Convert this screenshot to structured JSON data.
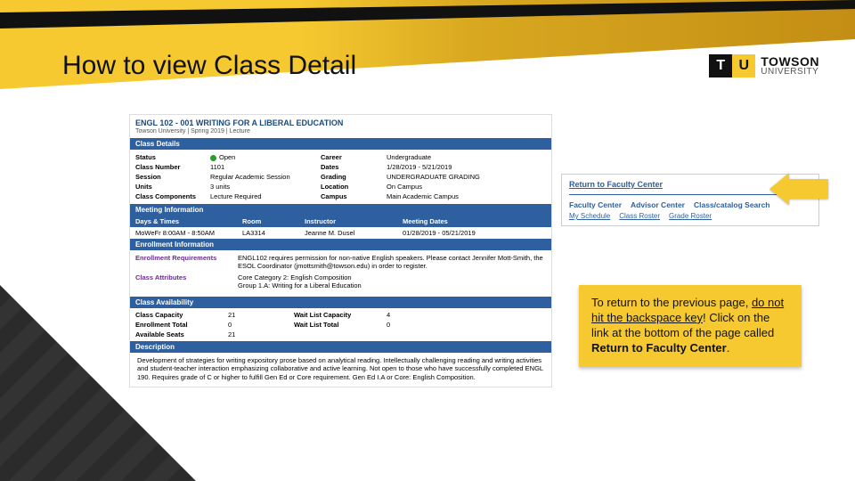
{
  "slide": {
    "title": "How to view Class Detail",
    "logo": {
      "mark1": "T",
      "mark2": "U",
      "line1": "TOWSON",
      "line2": "UNIVERSITY"
    }
  },
  "course": {
    "title": "ENGL 102 - 001   WRITING FOR A LIBERAL EDUCATION",
    "sub": "Towson University | Spring 2019 | Lecture"
  },
  "sections": {
    "classDetails": "Class Details",
    "meeting": "Meeting Information",
    "meetCols": {
      "days": "Days & Times",
      "room": "Room",
      "instr": "Instructor",
      "mdates": "Meeting Dates"
    },
    "enrollInfo": "Enrollment Information",
    "availability": "Class Availability",
    "description": "Description"
  },
  "details": {
    "statusLbl": "Status",
    "status": "Open",
    "classNumLbl": "Class Number",
    "classNum": "1101",
    "sessionLbl": "Session",
    "session": "Regular Academic Session",
    "unitsLbl": "Units",
    "units": "3 units",
    "compLbl": "Class Components",
    "comp": "Lecture Required",
    "careerLbl": "Career",
    "career": "Undergraduate",
    "datesLbl": "Dates",
    "dates": "1/28/2019 - 5/21/2019",
    "gradingLbl": "Grading",
    "grading": "UNDERGRADUATE GRADING",
    "locationLbl": "Location",
    "location": "On Campus",
    "campusLbl": "Campus",
    "campus": "Main Academic Campus"
  },
  "meeting": {
    "days": "MoWeFr 8:00AM - 8:50AM",
    "room": "LA3314",
    "instr": "Jeanne M. Dusel",
    "mdates": "01/28/2019 - 05/21/2019"
  },
  "enroll": {
    "reqLbl": "Enrollment Requirements",
    "req": "ENGL102 requires permission for non-native English speakers. Please contact Jennifer Mott-Smith, the ESOL Coordinator (jmottsmith@towson.edu) in order to register.",
    "attrLbl": "Class Attributes",
    "attr1": "Core Category 2: English Composition",
    "attr2": "Group 1.A: Writing for a Liberal Education"
  },
  "avail": {
    "capLbl": "Class Capacity",
    "cap": "21",
    "wlcapLbl": "Wait List Capacity",
    "wlcap": "4",
    "totLbl": "Enrollment Total",
    "tot": "0",
    "wltotLbl": "Wait List Total",
    "wltot": "0",
    "seatsLbl": "Available Seats",
    "seats": "21"
  },
  "desc": "Development of strategies for writing expository prose based on analytical reading. Intellectually challenging reading and writing activities and student-teacher interaction emphasizing collaborative and active learning. Not open to those who have successfully completed ENGL 190. Requires grade of C or higher to fulfill Gen Ed or Core requirement. Gen Ed I.A or Core: English Composition.",
  "nav": {
    "return": "Return to Faculty Center",
    "t1": "Faculty Center",
    "t2": "Advisor Center",
    "t3": "Class/catalog Search",
    "s1": "My Schedule",
    "s2": "Class Roster",
    "s3": "Grade Roster"
  },
  "callout": {
    "l1": "To return to the previous page, ",
    "l2": "do not hit the backspace key",
    "l3": "! Click on the link at the bottom of the page called ",
    "l4": "Return to Faculty Center",
    "l5": "."
  }
}
